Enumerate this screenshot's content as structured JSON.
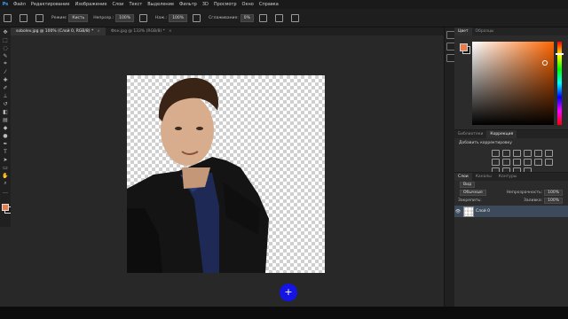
{
  "menubar": {
    "logo": "Ps",
    "items": [
      "Файл",
      "Редактирование",
      "Изображение",
      "Слои",
      "Текст",
      "Выделение",
      "Фильтр",
      "3D",
      "Просмотр",
      "Окно",
      "Справка"
    ]
  },
  "options": {
    "mode_label": "Режим:",
    "mode_value": "Кисть",
    "opacity_label": "Непрозр.:",
    "opacity_value": "100%",
    "pressure_label": "Наж.:",
    "pressure_value": "100%",
    "smoothing_label": "Сглаживание:",
    "smoothing_value": "0%"
  },
  "tabs": [
    {
      "label": "sobolev.jpg @ 100% (Слой 0, RGB/8) *",
      "close": "×"
    },
    {
      "label": "Фон.jpg @ 133% (RGB/8) *",
      "close": "×"
    }
  ],
  "cursor_symbol": "+",
  "panels": {
    "color_tabs": [
      "Цвет",
      "Образцы"
    ],
    "adjust_tabs": [
      "Библиотеки",
      "Коррекция"
    ],
    "adjust_add": "Добавить корректировку",
    "layer_tabs": [
      "Слои",
      "Каналы",
      "Контуры"
    ],
    "kind_label": "Вид",
    "blend_mode": "Обычные",
    "opacity_label": "Непрозрачность:",
    "opacity_value": "100%",
    "lock_label": "Закрепить:",
    "fill_label": "Заливка:",
    "fill_value": "100%",
    "layer_name": "Слой 0",
    "eye": "👁"
  },
  "colors": {
    "foreground": "#e87d4a",
    "background": "#1a1a1a",
    "accent": "#3d4a5c",
    "cursor": "#1414e6"
  },
  "icons": [
    "move-icon",
    "marquee-icon",
    "lasso-icon",
    "quick-select-icon",
    "crop-icon",
    "eyedropper-icon",
    "healing-icon",
    "brush-icon",
    "clone-stamp-icon",
    "history-brush-icon",
    "eraser-icon",
    "gradient-icon",
    "blur-icon",
    "dodge-icon",
    "pen-icon",
    "type-icon",
    "path-select-icon",
    "shape-icon",
    "hand-icon",
    "zoom-icon"
  ]
}
